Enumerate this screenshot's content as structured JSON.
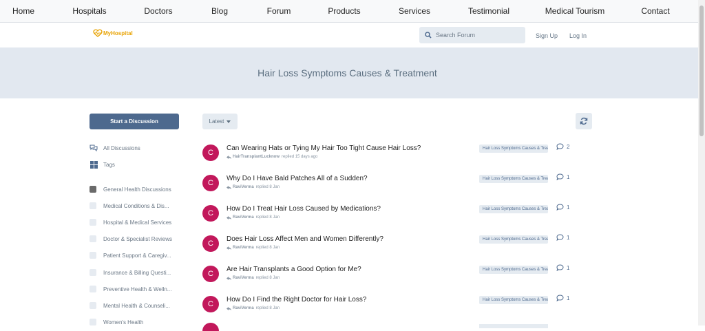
{
  "topnav": {
    "items": [
      "Home",
      "Hospitals",
      "Doctors",
      "Blog",
      "Forum",
      "Products",
      "Services",
      "Testimonial",
      "Medical Tourism",
      "Contact"
    ]
  },
  "header": {
    "logo_text": "MyHospital",
    "search_placeholder": "Search Forum",
    "sign_up": "Sign Up",
    "log_in": "Log In"
  },
  "hero": {
    "title": "Hair Loss Symptoms Causes & Treatment"
  },
  "sidebar": {
    "start_button": "Start a Discussion",
    "nav": [
      {
        "label": "All Discussions",
        "icon": "comments-icon"
      },
      {
        "label": "Tags",
        "icon": "tags-grid-icon"
      }
    ],
    "tags": [
      "General Health Discussions",
      "Medical Conditions & Dis...",
      "Hospital & Medical Services",
      "Doctor & Specialist Reviews",
      "Patient Support & Caregiv...",
      "Insurance & Billing Questi...",
      "Preventive Health & Welln...",
      "Mental Health & Counseli...",
      "Women's Health"
    ]
  },
  "toolbar": {
    "sort_label": "Latest",
    "refresh_icon": "refresh-icon"
  },
  "discussions": [
    {
      "avatar": "C",
      "title": "Can Wearing Hats or Tying My Hair Too Tight Cause Hair Loss?",
      "user": "HairTransplantLucknow",
      "time": "replied 15 days ago",
      "tag": "Hair Loss Symptoms Causes & Treatment",
      "replies": "2"
    },
    {
      "avatar": "C",
      "title": "Why Do I Have Bald Patches All of a Sudden?",
      "user": "RaviVerma",
      "time": "replied 8 Jan",
      "tag": "Hair Loss Symptoms Causes & Treatment",
      "replies": "1"
    },
    {
      "avatar": "C",
      "title": "How Do I Treat Hair Loss Caused by Medications?",
      "user": "RaviVerma",
      "time": "replied 8 Jan",
      "tag": "Hair Loss Symptoms Causes & Treatment",
      "replies": "1"
    },
    {
      "avatar": "C",
      "title": "Does Hair Loss Affect Men and Women Differently?",
      "user": "RaviVerma",
      "time": "replied 8 Jan",
      "tag": "Hair Loss Symptoms Causes & Treatment",
      "replies": "1"
    },
    {
      "avatar": "C",
      "title": "Are Hair Transplants a Good Option for Me?",
      "user": "RaviVerma",
      "time": "replied 8 Jan",
      "tag": "Hair Loss Symptoms Causes & Treatment",
      "replies": "1"
    },
    {
      "avatar": "C",
      "title": "How Do I Find the Right Doctor for Hair Loss?",
      "user": "RaviVerma",
      "time": "replied 8 Jan",
      "tag": "Hair Loss Symptoms Causes & Treatment",
      "replies": "1"
    }
  ],
  "colors": {
    "accent": "#4d698e",
    "avatar": "#c2185b",
    "hero_bg": "#e2e8f0",
    "logo": "#e8a200"
  }
}
